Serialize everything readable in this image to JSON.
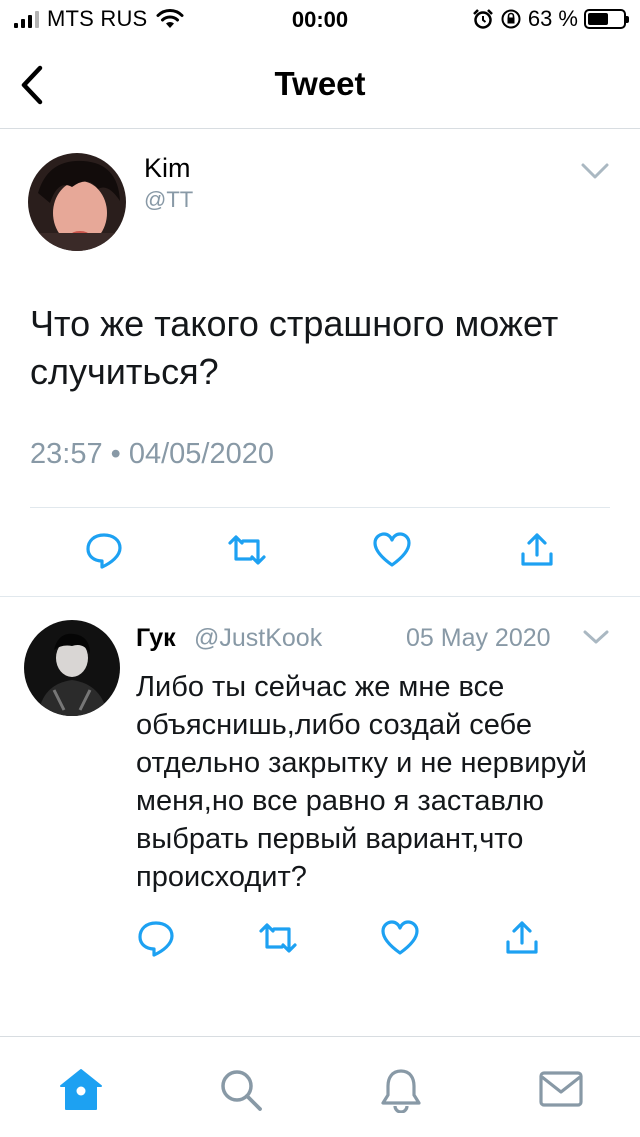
{
  "status_bar": {
    "carrier": "MTS RUS",
    "time": "00:00",
    "battery_percent_label": "63 %",
    "battery_level": 0.63
  },
  "nav": {
    "title": "Tweet"
  },
  "main_tweet": {
    "name": "Kim",
    "handle": "@TT",
    "text": "Что же такого страшного может случиться?",
    "timestamp": "23:57 • 04/05/2020"
  },
  "reply": {
    "name": "Гук",
    "handle": "@JustKook",
    "date": "05 May 2020",
    "text": "Либо ты сейчас же мне все объяснишь,либо создай себе отдельно закрытку и не нервируй меня,но все равно я заставлю выбрать первый вариант,что происходит?"
  },
  "colors": {
    "accent": "#1da1f2",
    "icon_gray": "#657786",
    "muted_text": "#8899a6",
    "divider": "#e1e8ed"
  },
  "icons": {
    "back": "chevron-left",
    "caret": "chevron-down",
    "reply": "speech-bubble",
    "retweet": "retweet-arrows",
    "like": "heart",
    "share": "share-arrow",
    "tab_home": "home",
    "tab_search": "magnifier",
    "tab_notifications": "bell",
    "tab_messages": "envelope"
  }
}
